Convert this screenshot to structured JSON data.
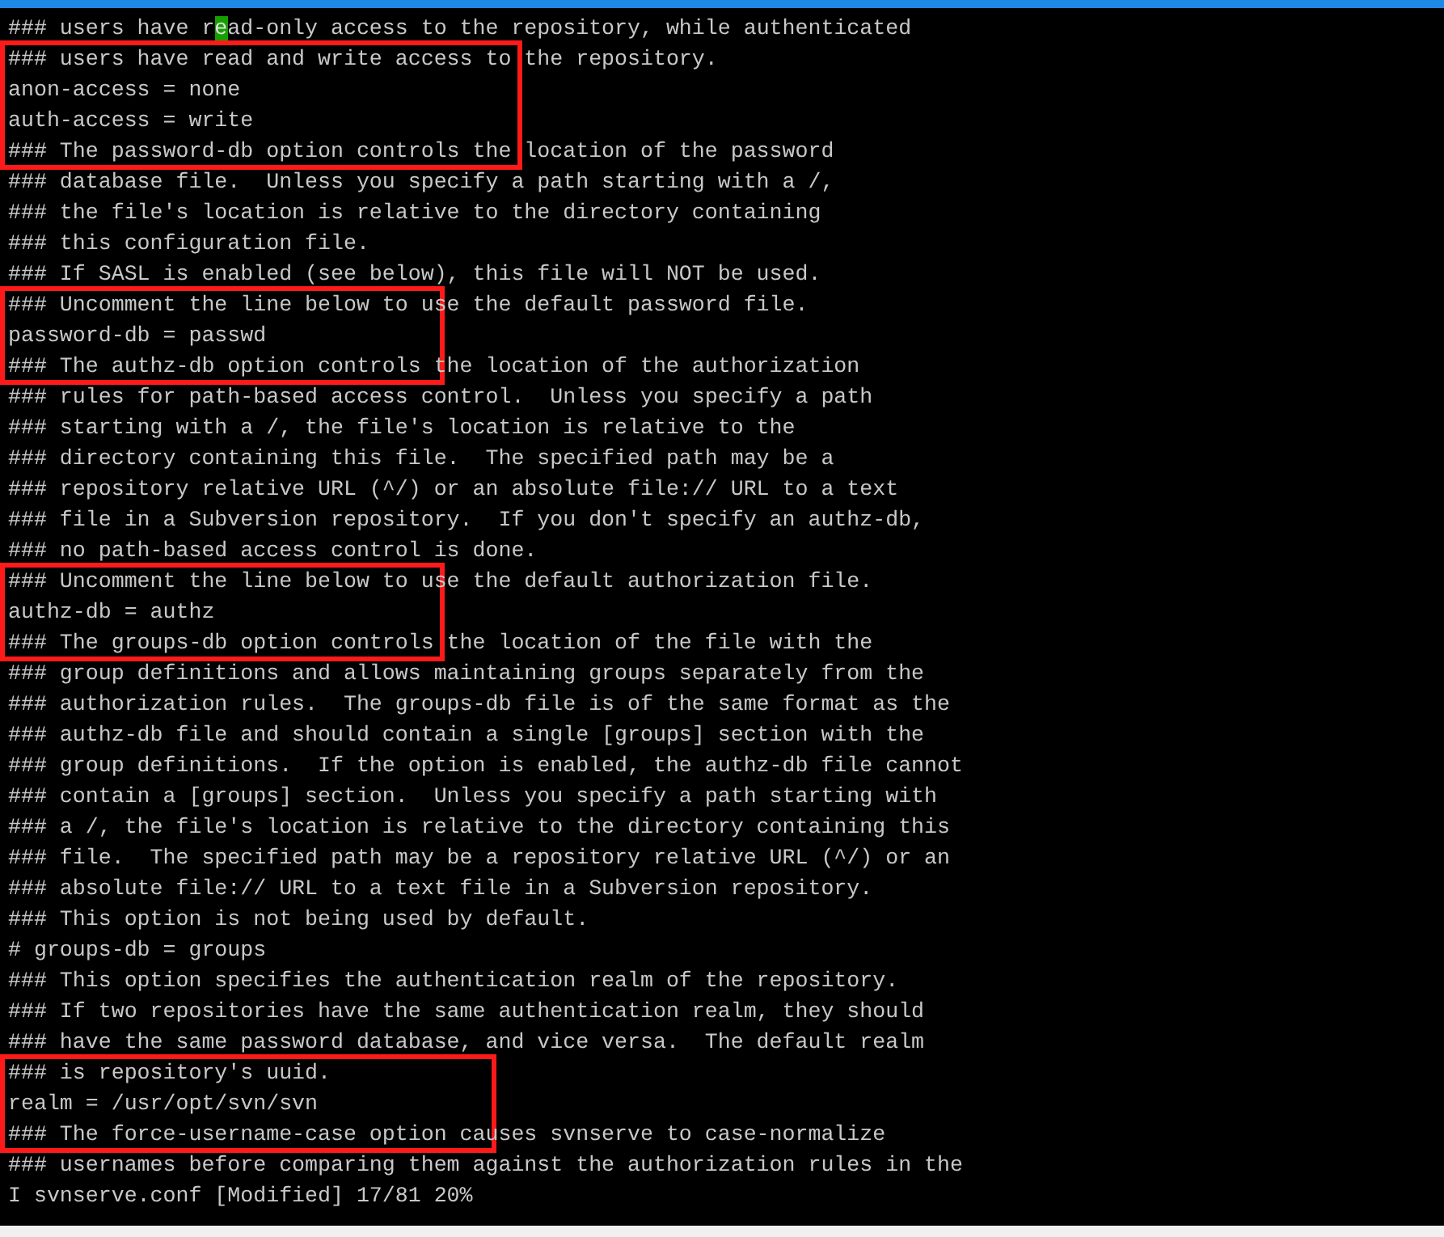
{
  "editor": {
    "lines": [
      {
        "text": "### users have read-only access to the repository, while authenticated",
        "cursor": true,
        "boxed": false
      },
      {
        "text": "### users have read and write access to the repository.",
        "cursor": false,
        "boxed": true
      },
      {
        "text": "anon-access = none",
        "cursor": false,
        "boxed": true
      },
      {
        "text": "auth-access = write",
        "cursor": false,
        "boxed": true
      },
      {
        "text": "### The password-db option controls the location of the password",
        "cursor": false,
        "boxed": true
      },
      {
        "text": "### database file.  Unless you specify a path starting with a /,",
        "cursor": false,
        "boxed": false
      },
      {
        "text": "### the file's location is relative to the directory containing",
        "cursor": false,
        "boxed": false
      },
      {
        "text": "### this configuration file.",
        "cursor": false,
        "boxed": false
      },
      {
        "text": "### If SASL is enabled (see below), this file will NOT be used.",
        "cursor": false,
        "boxed": false
      },
      {
        "text": "### Uncomment the line below to use the default password file.",
        "cursor": false,
        "boxed": true
      },
      {
        "text": "password-db = passwd",
        "cursor": false,
        "boxed": true
      },
      {
        "text": "### The authz-db option controls the location of the authorization",
        "cursor": false,
        "boxed": true
      },
      {
        "text": "### rules for path-based access control.  Unless you specify a path",
        "cursor": false,
        "boxed": false
      },
      {
        "text": "### starting with a /, the file's location is relative to the",
        "cursor": false,
        "boxed": false
      },
      {
        "text": "### directory containing this file.  The specified path may be a",
        "cursor": false,
        "boxed": false
      },
      {
        "text": "### repository relative URL (^/) or an absolute file:// URL to a text",
        "cursor": false,
        "boxed": false
      },
      {
        "text": "### file in a Subversion repository.  If you don't specify an authz-db,",
        "cursor": false,
        "boxed": false
      },
      {
        "text": "### no path-based access control is done.",
        "cursor": false,
        "boxed": false
      },
      {
        "text": "### Uncomment the line below to use the default authorization file.",
        "cursor": false,
        "boxed": true
      },
      {
        "text": "authz-db = authz",
        "cursor": false,
        "boxed": true
      },
      {
        "text": "### The groups-db option controls the location of the file with the",
        "cursor": false,
        "boxed": true
      },
      {
        "text": "### group definitions and allows maintaining groups separately from the",
        "cursor": false,
        "boxed": false
      },
      {
        "text": "### authorization rules.  The groups-db file is of the same format as the",
        "cursor": false,
        "boxed": false
      },
      {
        "text": "### authz-db file and should contain a single [groups] section with the",
        "cursor": false,
        "boxed": false
      },
      {
        "text": "### group definitions.  If the option is enabled, the authz-db file cannot",
        "cursor": false,
        "boxed": false
      },
      {
        "text": "### contain a [groups] section.  Unless you specify a path starting with",
        "cursor": false,
        "boxed": false
      },
      {
        "text": "### a /, the file's location is relative to the directory containing this",
        "cursor": false,
        "boxed": false
      },
      {
        "text": "### file.  The specified path may be a repository relative URL (^/) or an",
        "cursor": false,
        "boxed": false
      },
      {
        "text": "### absolute file:// URL to a text file in a Subversion repository.",
        "cursor": false,
        "boxed": false
      },
      {
        "text": "### This option is not being used by default.",
        "cursor": false,
        "boxed": false
      },
      {
        "text": "# groups-db = groups",
        "cursor": false,
        "boxed": false
      },
      {
        "text": "### This option specifies the authentication realm of the repository.",
        "cursor": false,
        "boxed": false
      },
      {
        "text": "### If two repositories have the same authentication realm, they should",
        "cursor": false,
        "boxed": false
      },
      {
        "text": "### have the same password database, and vice versa.  The default realm",
        "cursor": false,
        "boxed": false
      },
      {
        "text": "### is repository's uuid.",
        "cursor": false,
        "boxed": true
      },
      {
        "text": "realm = /usr/opt/svn/svn",
        "cursor": false,
        "boxed": true
      },
      {
        "text": "### The force-username-case option causes svnserve to case-normalize",
        "cursor": false,
        "boxed": true
      },
      {
        "text": "### usernames before comparing them against the authorization rules in the",
        "cursor": false,
        "boxed": false
      }
    ]
  },
  "status_bar": "I svnserve.conf [Modified] 17/81 20%"
}
